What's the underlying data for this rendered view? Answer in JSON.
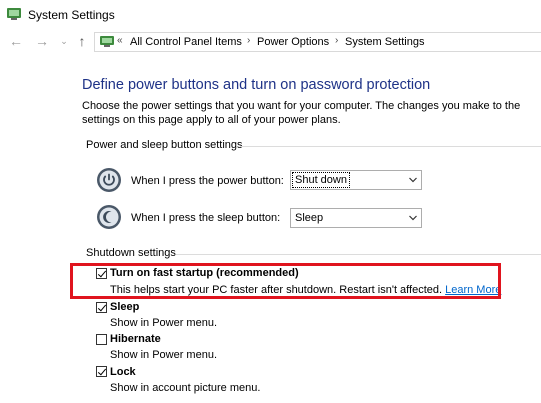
{
  "window": {
    "title": "System Settings"
  },
  "nav": {
    "back_icon": "arrow-left-icon",
    "forward_icon": "arrow-right-icon",
    "recent_icon": "chevron-down-icon",
    "up_icon": "arrow-up-icon"
  },
  "breadcrumb": {
    "overflow": "«",
    "items": [
      "All Control Panel Items",
      "Power Options",
      "System Settings"
    ],
    "separator": "›"
  },
  "main": {
    "heading": "Define power buttons and turn on password protection",
    "description": "Choose the power settings that you want for your computer. The changes you make to the settings on this page apply to all of your power plans."
  },
  "power_section": {
    "label": "Power and sleep button settings",
    "power_button": {
      "label": "When I press the power button:",
      "value": "Shut down"
    },
    "sleep_button": {
      "label": "When I press the sleep button:",
      "value": "Sleep"
    }
  },
  "shutdown_section": {
    "label": "Shutdown settings",
    "options": [
      {
        "title": "Turn on fast startup (recommended)",
        "description": "This helps start your PC faster after shutdown. Restart isn't affected.",
        "link": "Learn More",
        "checked": true
      },
      {
        "title": "Sleep",
        "description": "Show in Power menu.",
        "checked": true
      },
      {
        "title": "Hibernate",
        "description": "Show in Power menu.",
        "checked": false
      },
      {
        "title": "Lock",
        "description": "Show in account picture menu.",
        "checked": true
      }
    ]
  },
  "colors": {
    "heading": "#1e3287",
    "link": "#0066cc",
    "highlight": "#e0141e"
  }
}
